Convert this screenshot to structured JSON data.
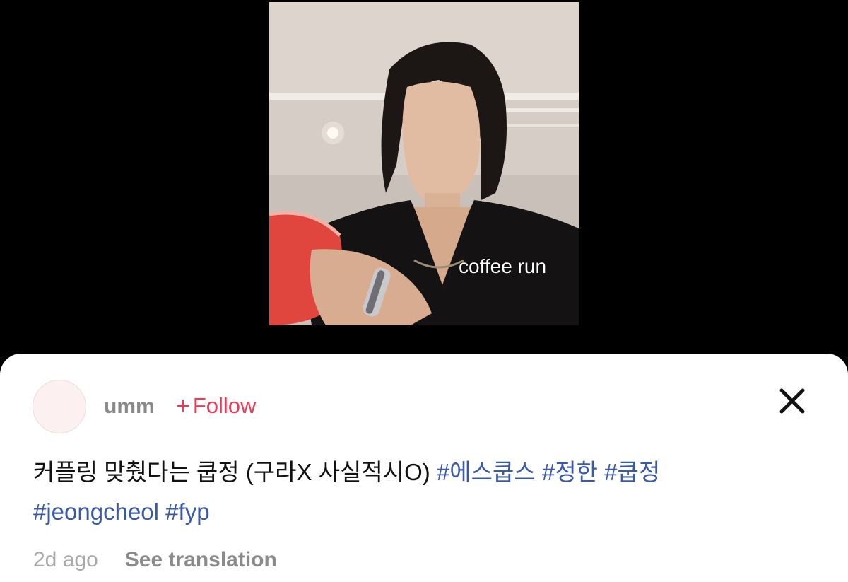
{
  "video": {
    "caption_overlay": "coffee run"
  },
  "post": {
    "username": "umm",
    "follow_plus": "+",
    "follow_label": "Follow",
    "description": "커플링 맞췄다는 쿱정 (구라X 사실적시O)",
    "hashtags": [
      "#에스쿱스",
      "#정한",
      "#쿱정",
      "#jeongcheol",
      "#fyp"
    ],
    "time_ago": "2d ago",
    "see_translation": "See translation"
  },
  "icons": {
    "close": "close-icon",
    "avatar": "avatar"
  },
  "colors": {
    "background": "#000000",
    "sheet": "#ffffff",
    "follow": "#ee3a57",
    "hashtag": "#3a5aa8",
    "username": "#8a8a8a",
    "meta": "#a9a9a9"
  }
}
